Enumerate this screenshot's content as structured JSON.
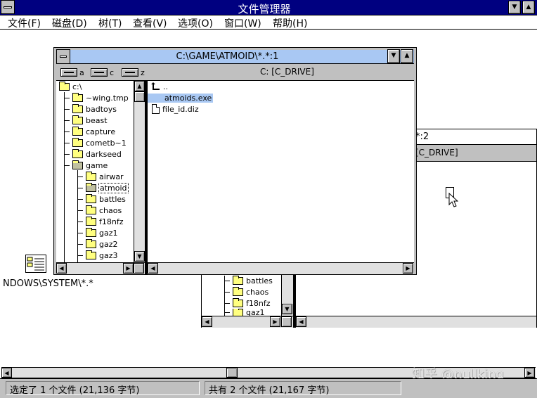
{
  "main_window": {
    "title": "文件管理器",
    "menu": [
      "文件(F)",
      "磁盘(D)",
      "树(T)",
      "查看(V)",
      "选项(O)",
      "窗口(W)",
      "帮助(H)"
    ]
  },
  "back_window": {
    "title_fragment": "*:2",
    "drive_label_fragment": "[C_DRIVE]",
    "tree_items": [
      "battles",
      "chaos",
      "f18nfz",
      "gaz1"
    ]
  },
  "front_window": {
    "title": "C:\\GAME\\ATMOID\\*.*:1",
    "drives": [
      {
        "letter": "a"
      },
      {
        "letter": "c"
      },
      {
        "letter": "z"
      }
    ],
    "drive_label": "C: [C_DRIVE]",
    "tree": {
      "root": "c:\\",
      "items": [
        "~wing.tmp",
        "badtoys",
        "beast",
        "capture",
        "cometb~1",
        "darkseed",
        "game"
      ],
      "game_children": [
        "airwar",
        "atmoid",
        "battles",
        "chaos",
        "f18nfz",
        "gaz1",
        "gaz2",
        "gaz3"
      ],
      "selected": "atmoid"
    },
    "files": {
      "parent": "..",
      "items": [
        {
          "name": "atmoids.exe",
          "selected": true
        },
        {
          "name": "file_id.diz",
          "selected": false
        }
      ]
    }
  },
  "minimized_window": {
    "label": "NDOWS\\SYSTEM\\*.*"
  },
  "status": {
    "selected": "选定了 1 个文件 (21,136 字节)",
    "total": "共有 2 个文件 (21,167 字节)"
  },
  "watermark": "知乎 @nullking",
  "colors": {
    "active_title": "#000080",
    "inactive_title": "#a9c8f3",
    "selection": "#a9c8f3",
    "folder": "#ffff80",
    "chrome": "#c0c0c0"
  }
}
